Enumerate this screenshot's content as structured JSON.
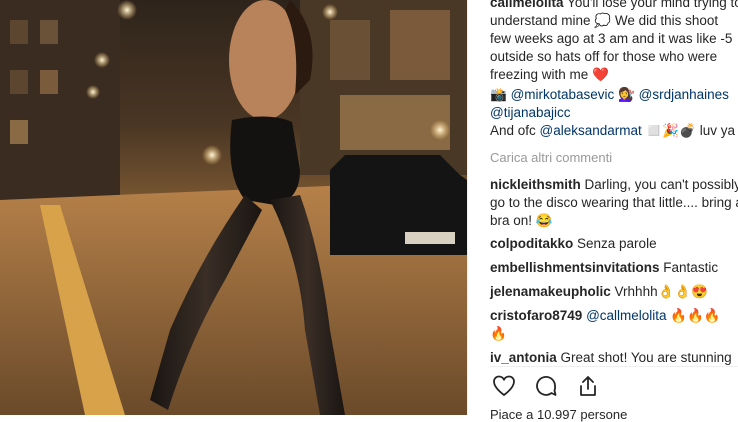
{
  "post": {
    "caption_lines": [
      {
        "user": "callmelolita",
        "text": " You'll lose your mind trying to"
      },
      {
        "text": "understand mine 💭 We did this shoot"
      },
      {
        "text": "few weeks ago at 3 am and it was like -5"
      },
      {
        "text": "outside so hats off for those who were"
      },
      {
        "text": "freezing with me ❤️"
      }
    ],
    "credits_line1": {
      "prefix": "📸 ",
      "mention1": "@mirkotabasevic",
      "mid": " 💇‍♀️ ",
      "mention2": "@srdjanhaines"
    },
    "credits_line2": {
      "mention": "@tijanabajicc"
    },
    "credits_line3": {
      "prefix": "And ofc ",
      "mention": "@aleksandarmat",
      "suffix": " ◻️🎉💣 luv ya"
    },
    "load_more": "Carica altri commenti"
  },
  "comments": [
    {
      "user": "nickleithsmith",
      "text": " Darling, you can't possibly"
    },
    {
      "text": "go to the disco wearing that little.... bring a"
    },
    {
      "text": "bra on! 😂"
    },
    {
      "user": "colpoditakko",
      "text": " Senza parole"
    },
    {
      "user": "embellishmentsinvitations",
      "text": " Fantastic"
    },
    {
      "user": "jelenamakeupholic",
      "text": " Vrhhhh👌👌😍"
    },
    {
      "user": "cristofaro8749",
      "text": " ",
      "mention": "@callmelolita",
      "suffix": " 🔥🔥🔥"
    },
    {
      "text": "🔥"
    },
    {
      "user": "iv_antonia",
      "text": " Great shot! You are stunning"
    }
  ],
  "actions": {
    "like_icon": "heart-icon",
    "comment_icon": "comment-icon",
    "share_icon": "share-icon"
  },
  "likes_text": "Piace a 10.997 persone",
  "colors": {
    "mention": "#003569",
    "muted": "#999999",
    "text": "#262626"
  }
}
